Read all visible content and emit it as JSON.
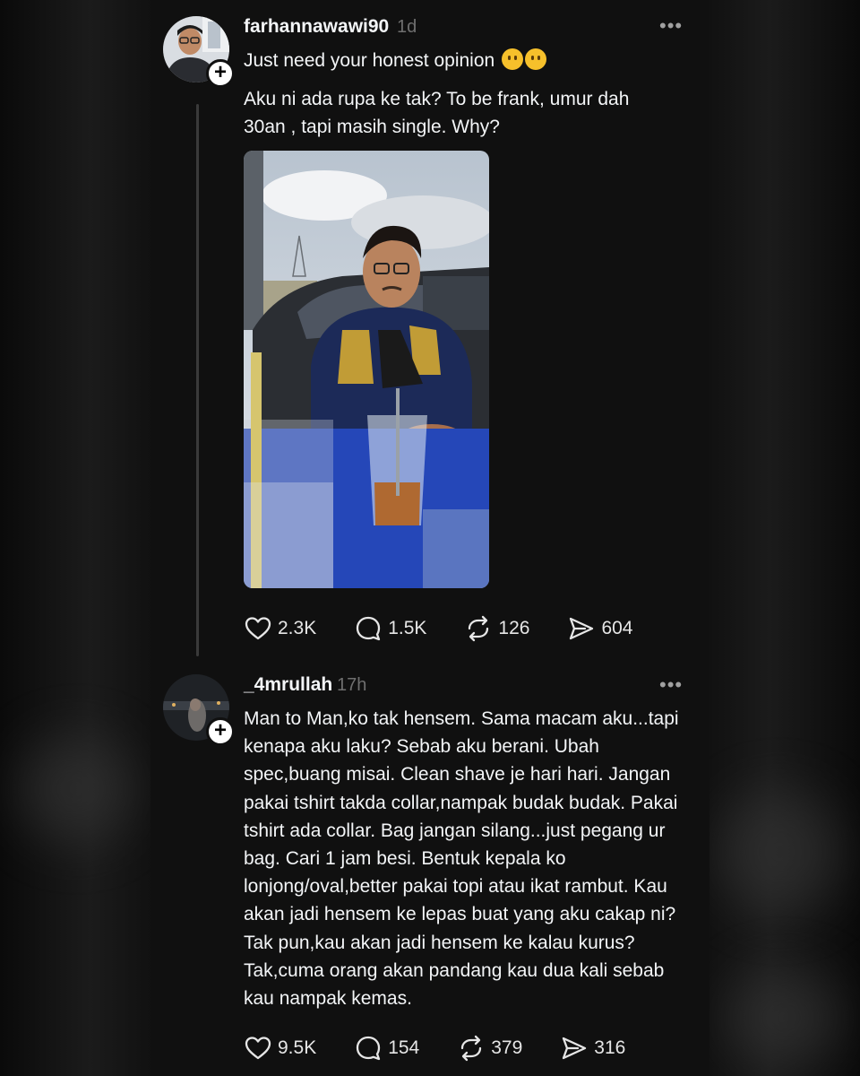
{
  "post": {
    "username": "farhannawawi90",
    "time": "1d",
    "more": "•••",
    "line1": "Just need your honest opinion",
    "body": "Aku ni ada rupa ke tak? To be frank, umur dah 30an , tapi masih single. Why?",
    "stats": {
      "likes": "2.3K",
      "replies": "1.5K",
      "reposts": "126",
      "shares": "604"
    }
  },
  "reply": {
    "username": "_4mrullah",
    "time": "17h",
    "more": "•••",
    "body": "Man to Man,ko tak hensem. Sama macam aku...tapi kenapa aku laku? Sebab aku berani. Ubah spec,buang misai. Clean shave je hari hari. Jangan pakai tshirt takda collar,nampak budak budak. Pakai tshirt ada collar. Bag jangan silang...just pegang ur bag. Cari 1 jam besi. Bentuk kepala ko lonjong/oval,better pakai topi atau ikat rambut. Kau akan jadi hensem ke lepas buat yang aku cakap ni? Tak pun,kau akan jadi hensem ke kalau kurus? Tak,cuma orang akan pandang kau dua kali sebab kau nampak kemas.",
    "stats": {
      "likes": "9.5K",
      "replies": "154",
      "reposts": "379",
      "shares": "316"
    }
  },
  "icons": {
    "like": "heart-icon",
    "reply": "comment-icon",
    "repost": "repost-icon",
    "share": "share-icon",
    "follow": "plus-icon"
  },
  "follow_symbol": "+"
}
